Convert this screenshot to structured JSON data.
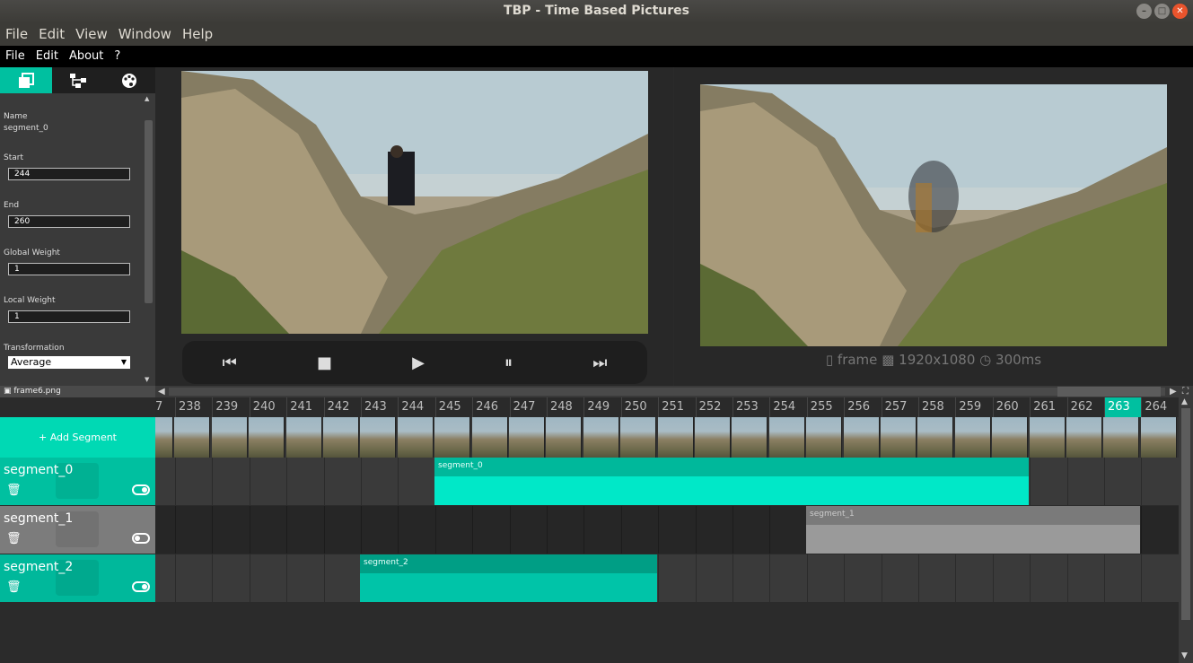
{
  "window": {
    "title": "TBP - Time Based Pictures"
  },
  "menu_main": [
    "File",
    "Edit",
    "View",
    "Window",
    "Help"
  ],
  "menu_app": [
    "File",
    "Edit",
    "About",
    "?"
  ],
  "props": {
    "name_label": "Name",
    "name_value": "segment_0",
    "start_label": "Start",
    "start_value": "244",
    "end_label": "End",
    "end_value": "260",
    "gw_label": "Global Weight",
    "gw_value": "1",
    "lw_label": "Local Weight",
    "lw_value": "1",
    "transform_label": "Transformation",
    "transform_value": "Average"
  },
  "status_file": "frame6.png",
  "frame_info": {
    "label": "frame",
    "resolution": "1920x1080",
    "duration": "300ms"
  },
  "ruler": [
    "7",
    "238",
    "239",
    "240",
    "241",
    "242",
    "243",
    "244",
    "245",
    "246",
    "247",
    "248",
    "249",
    "250",
    "251",
    "252",
    "253",
    "254",
    "255",
    "256",
    "257",
    "258",
    "259",
    "260",
    "261",
    "262",
    "263",
    "264"
  ],
  "ruler_active": "263",
  "add_segment": "+ Add Segment",
  "segments": [
    {
      "name": "segment_0",
      "enabled": true,
      "color": "#00e8c8"
    },
    {
      "name": "segment_1",
      "enabled": false,
      "color": "#9a9a9a"
    },
    {
      "name": "segment_2",
      "enabled": true,
      "color": "#00c4a8"
    }
  ],
  "colors": {
    "accent": "#00c0a0",
    "bg": "#2b2b2b"
  }
}
